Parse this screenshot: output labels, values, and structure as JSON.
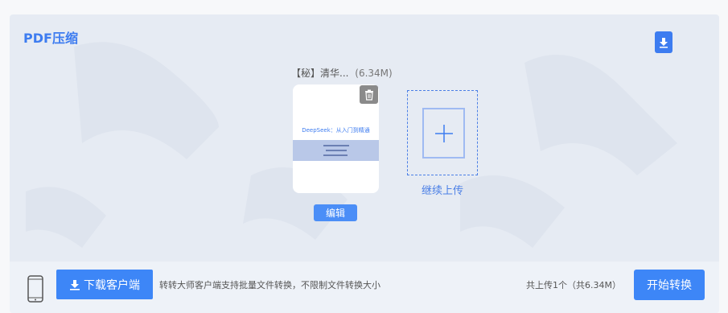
{
  "page": {
    "title": "PDF压缩"
  },
  "file": {
    "name": "【秘】清华...",
    "size": "(6.34M)",
    "preview_title": "DeepSeek：从入门到精通",
    "delete_icon": "trash-icon",
    "edit_label": "编辑"
  },
  "upload": {
    "label": "继续上传",
    "icon": "plus-icon"
  },
  "footer": {
    "client_button_label": "下载客户端",
    "hint": "转转大师客户端支持批量文件转换，不限制文件转换大小",
    "summary": "共上传1个（共6.34M）",
    "start_button_label": "开始转换"
  },
  "colors": {
    "accent": "#3d7cf0",
    "button": "#3d86f7",
    "panel_bg": "#e6ebf3"
  }
}
